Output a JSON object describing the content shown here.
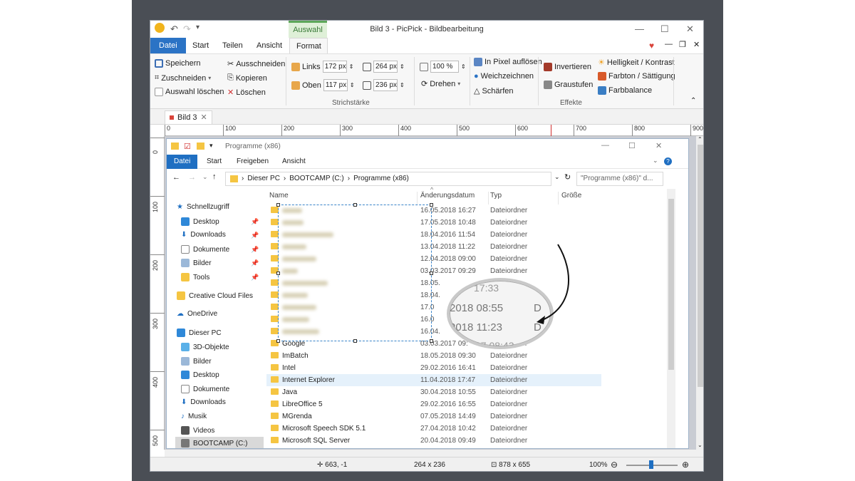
{
  "title_bar": {
    "title": "Bild 3 - PicPick - Bildbearbeitung",
    "context_tab": "Auswahl"
  },
  "ribbon_tabs": [
    "Datei",
    "Start",
    "Teilen",
    "Ansicht",
    "Format"
  ],
  "ribbon": {
    "save": "Speichern",
    "crop": "Zuschneiden",
    "crop_arrow": "▾",
    "delete_sel": "Auswahl löschen",
    "cut": "Ausschneiden",
    "copy": "Kopieren",
    "delete": "Löschen",
    "left_label": "Links",
    "left_val": "172 px",
    "width_val": "264 px",
    "top_label": "Oben",
    "top_val": "117 px",
    "height_val": "236 px",
    "zoom_val": "100 %",
    "rotate": "Drehen",
    "pixelate": "In Pixel auflösen",
    "soften": "Weichzeichnen",
    "sharpen": "Schärfen",
    "invert": "Invertieren",
    "grayscale": "Graustufen",
    "brightness": "Helligkeit / Kontrast",
    "hue": "Farbton / Sättigung",
    "colorbal": "Farbbalance",
    "group_stroke": "Strichstärke",
    "group_effects": "Effekte"
  },
  "doc_tab": "Bild 3",
  "ruler_h": [
    "0",
    "100",
    "200",
    "300",
    "400",
    "500",
    "600",
    "700",
    "800",
    "900"
  ],
  "ruler_v": [
    "0",
    "100",
    "200",
    "300",
    "400",
    "500"
  ],
  "explorer": {
    "title": "Programme (x86)",
    "tabs": [
      "Datei",
      "Start",
      "Freigeben",
      "Ansicht"
    ],
    "path": [
      "Dieser PC",
      "BOOTCAMP (C:)",
      "Programme (x86)"
    ],
    "search": "\"Programme (x86)\" d...",
    "columns": [
      "Name",
      "Änderungsdatum",
      "Typ",
      "Größe"
    ],
    "nav": {
      "quick": "Schnellzugriff",
      "quick_items": [
        "Desktop",
        "Downloads",
        "Dokumente",
        "Bilder",
        "Tools"
      ],
      "creative": "Creative Cloud Files",
      "onedrive": "OneDrive",
      "thispc": "Dieser PC",
      "pc_items": [
        "3D-Objekte",
        "Bilder",
        "Desktop",
        "Dokumente",
        "Downloads",
        "Musik",
        "Videos",
        "BOOTCAMP (C:)"
      ]
    },
    "blurred_rows": [
      {
        "d": "16.05.2018 16:27",
        "t": "Dateiordner"
      },
      {
        "d": "17.05.2018 10:48",
        "t": "Dateiordner"
      },
      {
        "d": "18.04.2016 11:54",
        "t": "Dateiordner"
      },
      {
        "d": "13.04.2018 11:22",
        "t": "Dateiordner"
      },
      {
        "d": "12.04.2018 09:00",
        "t": "Dateiordner"
      },
      {
        "d": "03.03.2017 09:29",
        "t": "Dateiordner"
      },
      {
        "d": "18.05.",
        "t": ""
      },
      {
        "d": "18.04.",
        "t": ""
      },
      {
        "d": "17.0",
        "t": ""
      },
      {
        "d": "16.0",
        "t": ""
      },
      {
        "d": "16.04.",
        "t": ""
      }
    ],
    "rows": [
      {
        "n": "Google",
        "d": "03.03.2017 09:",
        "t": "Dateiordner"
      },
      {
        "n": "ImBatch",
        "d": "18.05.2018 09:30",
        "t": "Dateiordner"
      },
      {
        "n": "Intel",
        "d": "29.02.2016 16:41",
        "t": "Dateiordner"
      },
      {
        "n": "Internet Explorer",
        "d": "11.04.2018 17:47",
        "t": "Dateiordner"
      },
      {
        "n": "Java",
        "d": "30.04.2018 10:55",
        "t": "Dateiordner"
      },
      {
        "n": "LibreOffice 5",
        "d": "29.02.2016 16:55",
        "t": "Dateiordner"
      },
      {
        "n": "MGrenda",
        "d": "07.05.2018 14:49",
        "t": "Dateiordner"
      },
      {
        "n": "Microsoft Speech SDK 5.1",
        "d": "27.04.2018 10:42",
        "t": "Dateiordner"
      },
      {
        "n": "Microsoft SQL Server",
        "d": "20.04.2018 09:49",
        "t": "Dateiordner"
      }
    ]
  },
  "magnifier": [
    "17:33",
    "2018 08:55",
    "2018 11:23",
    "17 08:43",
    "D",
    "D"
  ],
  "status": {
    "pos": "663, -1",
    "size": "264 x 236",
    "img": "878 x 655",
    "zoom": "100%"
  }
}
